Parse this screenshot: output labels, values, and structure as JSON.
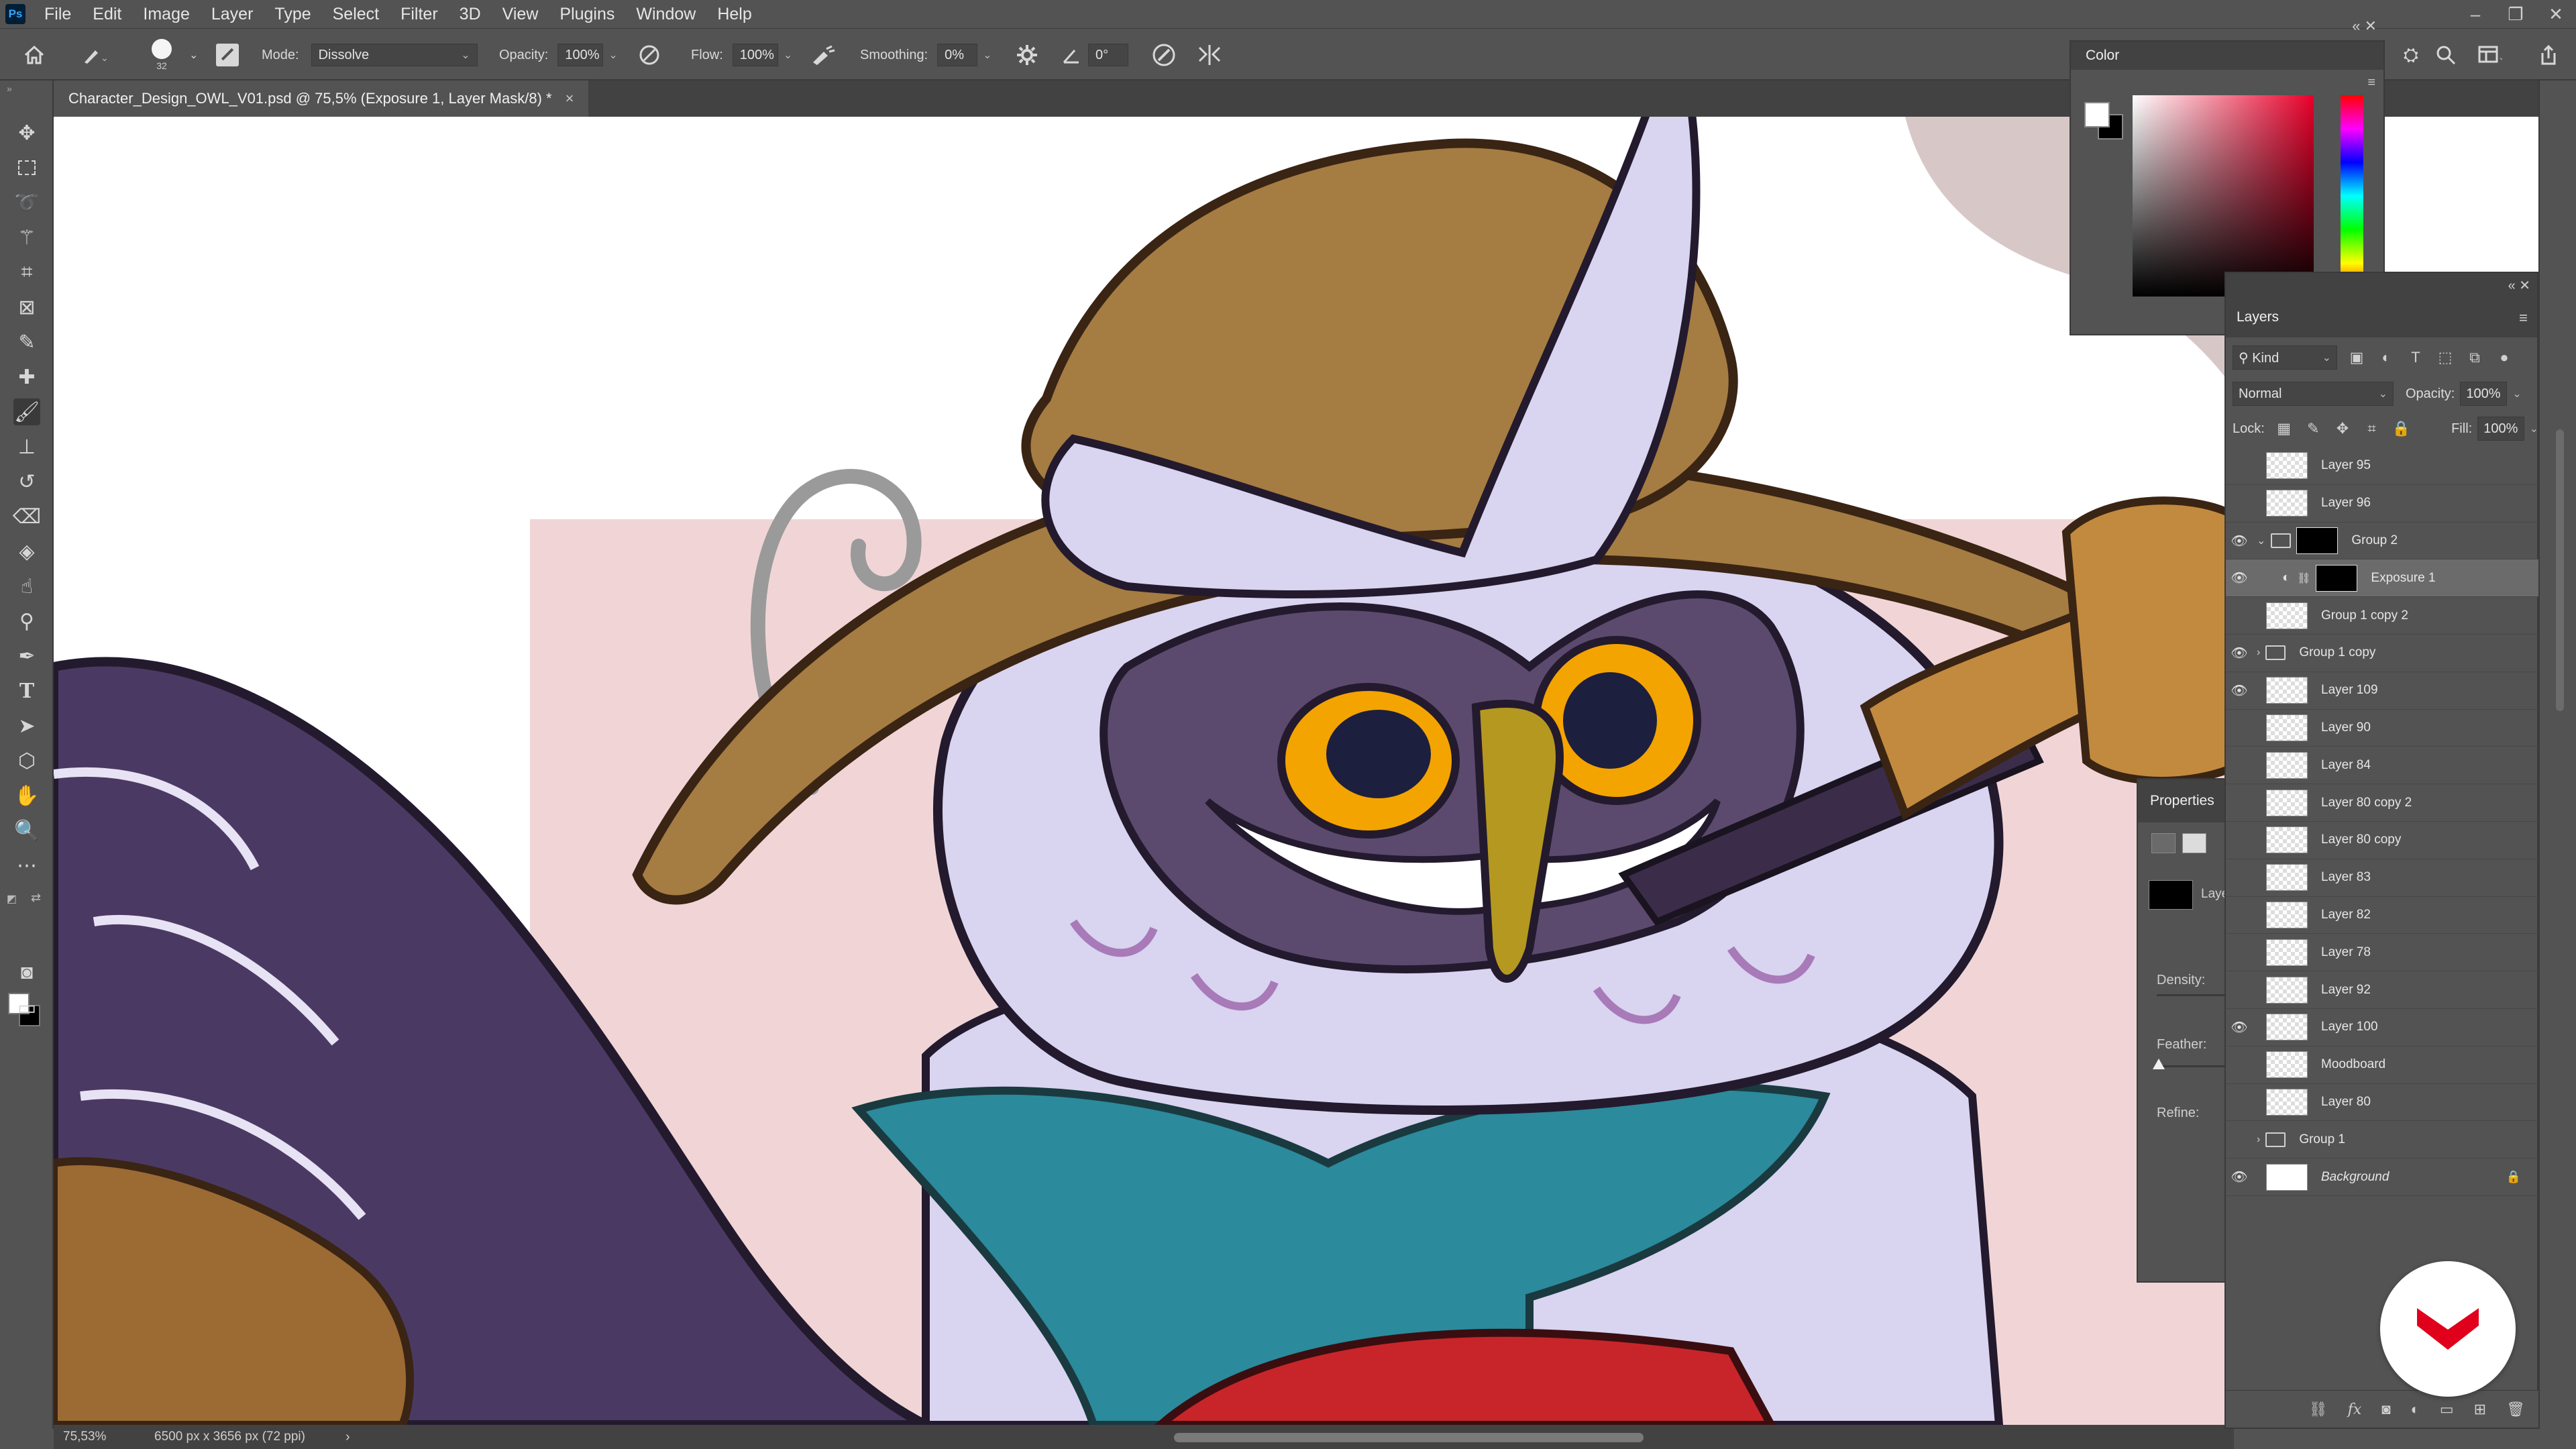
{
  "app": {
    "logo_text": "Ps"
  },
  "menu": [
    "File",
    "Edit",
    "Image",
    "Layer",
    "Type",
    "Select",
    "Filter",
    "3D",
    "View",
    "Plugins",
    "Window",
    "Help"
  ],
  "options_bar": {
    "brush_size": "32",
    "mode_label": "Mode:",
    "mode_value": "Dissolve",
    "opacity_label": "Opacity:",
    "opacity_value": "100%",
    "flow_label": "Flow:",
    "flow_value": "100%",
    "smoothing_label": "Smoothing:",
    "smoothing_value": "0%",
    "angle_value": "0°"
  },
  "document": {
    "tab_title": "Character_Design_OWL_V01.psd @ 75,5% (Exposure 1, Layer Mask/8) *",
    "close_glyph": "×"
  },
  "status_bar": {
    "zoom": "75,53%",
    "doc_info": "6500 px x 3656 px (72 ppi)",
    "arrow": "›"
  },
  "color_panel": {
    "title": "Color",
    "foreground": "#ffffff",
    "background": "#000000"
  },
  "properties_panel": {
    "title": "Properties",
    "thumb_label": "Laye",
    "density_label": "Density:",
    "feather_label": "Feather:",
    "refine_label": "Refine:"
  },
  "layers_panel": {
    "title": "Layers",
    "filter_kind": "Kind",
    "blend_mode": "Normal",
    "opacity_label": "Opacity:",
    "opacity_value": "100%",
    "lock_label": "Lock:",
    "fill_label": "Fill:",
    "fill_value": "100%",
    "layers": [
      {
        "name": "Layer 95",
        "visible": false,
        "kind": "layer"
      },
      {
        "name": "Layer 96",
        "visible": false,
        "kind": "layer"
      },
      {
        "name": "Group 2",
        "visible": true,
        "kind": "group-open"
      },
      {
        "name": "Exposure 1",
        "visible": true,
        "kind": "adjustment",
        "selected": true
      },
      {
        "name": "Group 1 copy 2",
        "visible": false,
        "kind": "layer"
      },
      {
        "name": "Group 1 copy",
        "visible": true,
        "kind": "group"
      },
      {
        "name": "Layer 109",
        "visible": true,
        "kind": "layer"
      },
      {
        "name": "Layer 90",
        "visible": false,
        "kind": "layer"
      },
      {
        "name": "Layer 84",
        "visible": false,
        "kind": "layer"
      },
      {
        "name": "Layer 80 copy 2",
        "visible": false,
        "kind": "layer"
      },
      {
        "name": "Layer 80 copy",
        "visible": false,
        "kind": "layer"
      },
      {
        "name": "Layer 83",
        "visible": false,
        "kind": "layer"
      },
      {
        "name": "Layer 82",
        "visible": false,
        "kind": "layer"
      },
      {
        "name": "Layer 78",
        "visible": false,
        "kind": "layer"
      },
      {
        "name": "Layer 92",
        "visible": false,
        "kind": "layer"
      },
      {
        "name": "Layer 100",
        "visible": true,
        "kind": "layer"
      },
      {
        "name": "Moodboard",
        "visible": false,
        "kind": "layer"
      },
      {
        "name": "Layer 80",
        "visible": false,
        "kind": "layer"
      },
      {
        "name": "Group 1",
        "visible": false,
        "kind": "group"
      },
      {
        "name": "Background",
        "visible": true,
        "kind": "background",
        "locked": true
      }
    ]
  },
  "colors": {
    "ui_bg": "#535353",
    "panel_header": "#424242",
    "selected_row": "#6b6b6b",
    "owl_feather": "#d9d4f0",
    "hat": "#a57c42",
    "scarf": "#2b8a9c",
    "coat": "#4a3a63",
    "eye": "#f4a400",
    "pink_bg": "#f1d5d6",
    "badge_red": "#e0001b"
  }
}
